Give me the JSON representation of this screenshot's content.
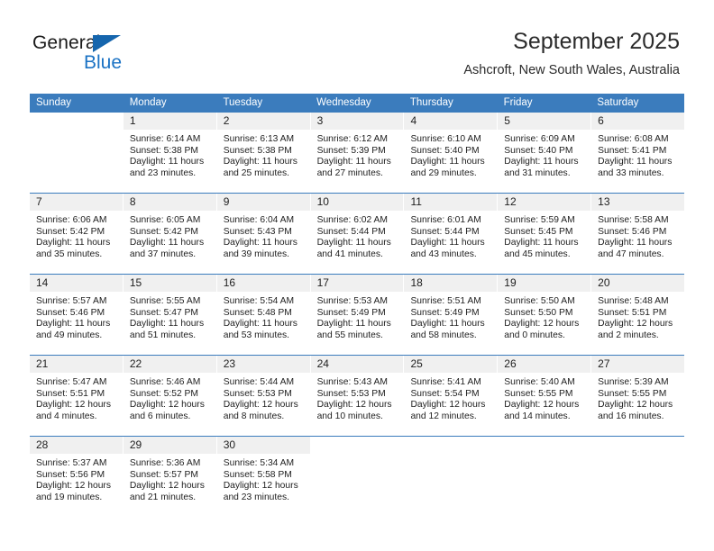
{
  "brand": {
    "name_part1": "General",
    "name_part2": "Blue",
    "triangle_color": "#1565ad",
    "blue_color": "#1a72c4"
  },
  "header": {
    "title": "September 2025",
    "subtitle": "Ashcroft, New South Wales, Australia"
  },
  "theme": {
    "header_bar_color": "#3b7cbd",
    "daynum_band_color": "#f0f0f0",
    "text_color": "#1e1e1e"
  },
  "weekdays": [
    "Sunday",
    "Monday",
    "Tuesday",
    "Wednesday",
    "Thursday",
    "Friday",
    "Saturday"
  ],
  "weeks": [
    [
      {
        "day": "",
        "lines": []
      },
      {
        "day": "1",
        "lines": [
          "Sunrise: 6:14 AM",
          "Sunset: 5:38 PM",
          "Daylight: 11 hours",
          "and 23 minutes."
        ]
      },
      {
        "day": "2",
        "lines": [
          "Sunrise: 6:13 AM",
          "Sunset: 5:38 PM",
          "Daylight: 11 hours",
          "and 25 minutes."
        ]
      },
      {
        "day": "3",
        "lines": [
          "Sunrise: 6:12 AM",
          "Sunset: 5:39 PM",
          "Daylight: 11 hours",
          "and 27 minutes."
        ]
      },
      {
        "day": "4",
        "lines": [
          "Sunrise: 6:10 AM",
          "Sunset: 5:40 PM",
          "Daylight: 11 hours",
          "and 29 minutes."
        ]
      },
      {
        "day": "5",
        "lines": [
          "Sunrise: 6:09 AM",
          "Sunset: 5:40 PM",
          "Daylight: 11 hours",
          "and 31 minutes."
        ]
      },
      {
        "day": "6",
        "lines": [
          "Sunrise: 6:08 AM",
          "Sunset: 5:41 PM",
          "Daylight: 11 hours",
          "and 33 minutes."
        ]
      }
    ],
    [
      {
        "day": "7",
        "lines": [
          "Sunrise: 6:06 AM",
          "Sunset: 5:42 PM",
          "Daylight: 11 hours",
          "and 35 minutes."
        ]
      },
      {
        "day": "8",
        "lines": [
          "Sunrise: 6:05 AM",
          "Sunset: 5:42 PM",
          "Daylight: 11 hours",
          "and 37 minutes."
        ]
      },
      {
        "day": "9",
        "lines": [
          "Sunrise: 6:04 AM",
          "Sunset: 5:43 PM",
          "Daylight: 11 hours",
          "and 39 minutes."
        ]
      },
      {
        "day": "10",
        "lines": [
          "Sunrise: 6:02 AM",
          "Sunset: 5:44 PM",
          "Daylight: 11 hours",
          "and 41 minutes."
        ]
      },
      {
        "day": "11",
        "lines": [
          "Sunrise: 6:01 AM",
          "Sunset: 5:44 PM",
          "Daylight: 11 hours",
          "and 43 minutes."
        ]
      },
      {
        "day": "12",
        "lines": [
          "Sunrise: 5:59 AM",
          "Sunset: 5:45 PM",
          "Daylight: 11 hours",
          "and 45 minutes."
        ]
      },
      {
        "day": "13",
        "lines": [
          "Sunrise: 5:58 AM",
          "Sunset: 5:46 PM",
          "Daylight: 11 hours",
          "and 47 minutes."
        ]
      }
    ],
    [
      {
        "day": "14",
        "lines": [
          "Sunrise: 5:57 AM",
          "Sunset: 5:46 PM",
          "Daylight: 11 hours",
          "and 49 minutes."
        ]
      },
      {
        "day": "15",
        "lines": [
          "Sunrise: 5:55 AM",
          "Sunset: 5:47 PM",
          "Daylight: 11 hours",
          "and 51 minutes."
        ]
      },
      {
        "day": "16",
        "lines": [
          "Sunrise: 5:54 AM",
          "Sunset: 5:48 PM",
          "Daylight: 11 hours",
          "and 53 minutes."
        ]
      },
      {
        "day": "17",
        "lines": [
          "Sunrise: 5:53 AM",
          "Sunset: 5:49 PM",
          "Daylight: 11 hours",
          "and 55 minutes."
        ]
      },
      {
        "day": "18",
        "lines": [
          "Sunrise: 5:51 AM",
          "Sunset: 5:49 PM",
          "Daylight: 11 hours",
          "and 58 minutes."
        ]
      },
      {
        "day": "19",
        "lines": [
          "Sunrise: 5:50 AM",
          "Sunset: 5:50 PM",
          "Daylight: 12 hours",
          "and 0 minutes."
        ]
      },
      {
        "day": "20",
        "lines": [
          "Sunrise: 5:48 AM",
          "Sunset: 5:51 PM",
          "Daylight: 12 hours",
          "and 2 minutes."
        ]
      }
    ],
    [
      {
        "day": "21",
        "lines": [
          "Sunrise: 5:47 AM",
          "Sunset: 5:51 PM",
          "Daylight: 12 hours",
          "and 4 minutes."
        ]
      },
      {
        "day": "22",
        "lines": [
          "Sunrise: 5:46 AM",
          "Sunset: 5:52 PM",
          "Daylight: 12 hours",
          "and 6 minutes."
        ]
      },
      {
        "day": "23",
        "lines": [
          "Sunrise: 5:44 AM",
          "Sunset: 5:53 PM",
          "Daylight: 12 hours",
          "and 8 minutes."
        ]
      },
      {
        "day": "24",
        "lines": [
          "Sunrise: 5:43 AM",
          "Sunset: 5:53 PM",
          "Daylight: 12 hours",
          "and 10 minutes."
        ]
      },
      {
        "day": "25",
        "lines": [
          "Sunrise: 5:41 AM",
          "Sunset: 5:54 PM",
          "Daylight: 12 hours",
          "and 12 minutes."
        ]
      },
      {
        "day": "26",
        "lines": [
          "Sunrise: 5:40 AM",
          "Sunset: 5:55 PM",
          "Daylight: 12 hours",
          "and 14 minutes."
        ]
      },
      {
        "day": "27",
        "lines": [
          "Sunrise: 5:39 AM",
          "Sunset: 5:55 PM",
          "Daylight: 12 hours",
          "and 16 minutes."
        ]
      }
    ],
    [
      {
        "day": "28",
        "lines": [
          "Sunrise: 5:37 AM",
          "Sunset: 5:56 PM",
          "Daylight: 12 hours",
          "and 19 minutes."
        ]
      },
      {
        "day": "29",
        "lines": [
          "Sunrise: 5:36 AM",
          "Sunset: 5:57 PM",
          "Daylight: 12 hours",
          "and 21 minutes."
        ]
      },
      {
        "day": "30",
        "lines": [
          "Sunrise: 5:34 AM",
          "Sunset: 5:58 PM",
          "Daylight: 12 hours",
          "and 23 minutes."
        ]
      },
      {
        "day": "",
        "lines": []
      },
      {
        "day": "",
        "lines": []
      },
      {
        "day": "",
        "lines": []
      },
      {
        "day": "",
        "lines": []
      }
    ]
  ]
}
